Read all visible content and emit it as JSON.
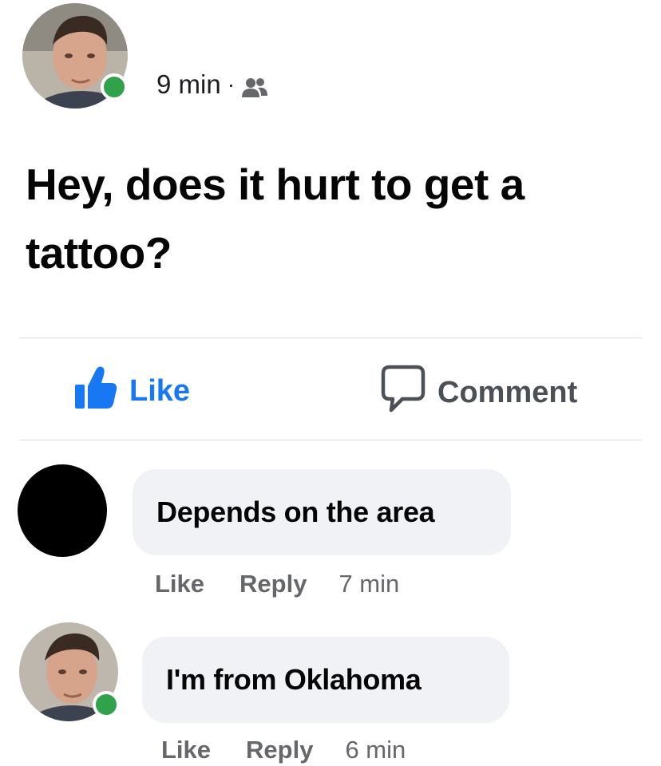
{
  "post": {
    "time": "9 min",
    "separator": "·",
    "audience_icon": "friends-icon",
    "text": "Hey, does it hurt to get a tattoo?"
  },
  "actions": {
    "like_label": "Like",
    "comment_label": "Comment"
  },
  "comments": [
    {
      "text": "Depends on the area",
      "like_label": "Like",
      "reply_label": "Reply",
      "time": "7 min"
    },
    {
      "text": "I'm from Oklahoma",
      "like_label": "Like",
      "reply_label": "Reply",
      "time": "6 min"
    }
  ],
  "colors": {
    "accent_blue": "#1877f2",
    "online_green": "#31a24c",
    "bubble_bg": "#f0f2f5",
    "secondary_text": "#65676b"
  }
}
